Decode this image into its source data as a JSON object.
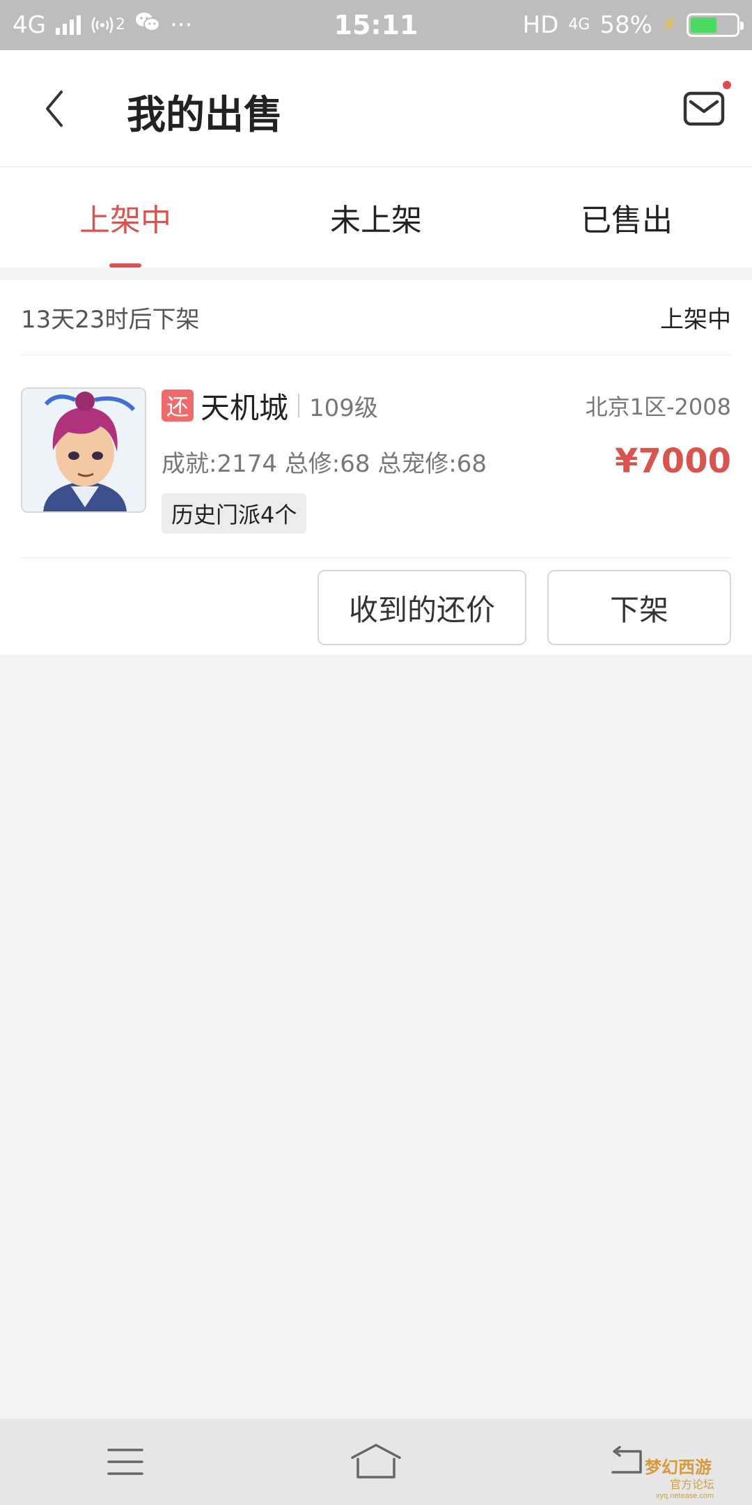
{
  "status_bar": {
    "network": "4G",
    "hotspot_count": "2",
    "more": "···",
    "time": "15:11",
    "hd": "HD",
    "network_right": "4G",
    "battery": "58%"
  },
  "header": {
    "title": "我的出售"
  },
  "tabs": [
    {
      "label": "上架中",
      "active": true
    },
    {
      "label": "未上架",
      "active": false
    },
    {
      "label": "已售出",
      "active": false
    }
  ],
  "listing": {
    "countdown": "13天23时后下架",
    "status": "上架中",
    "return_badge": "还",
    "server_name": "天机城",
    "level": "109级",
    "region": "北京1区-2008",
    "stats": "成就:2174 总修:68 总宠修:68",
    "price": "¥7000",
    "tag": "历史门派4个",
    "actions": {
      "offers": "收到的还价",
      "delist": "下架"
    }
  },
  "watermark": {
    "line1": "梦幻西游",
    "line2": "官方论坛",
    "url": "xyq.netease.com"
  },
  "colors": {
    "accent": "#d9534f",
    "status_bar": "#bdbdbd",
    "background": "#f3f3f3"
  }
}
